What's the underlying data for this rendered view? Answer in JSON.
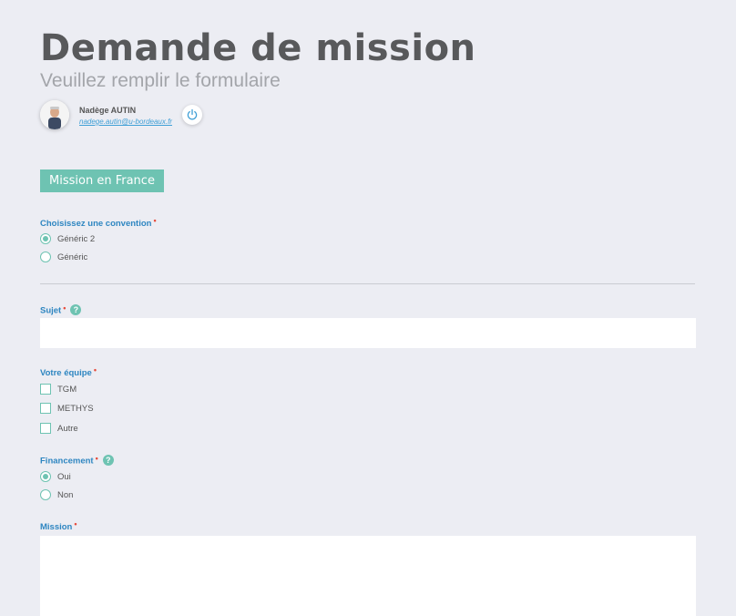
{
  "header": {
    "title": "Demande de mission",
    "subtitle": "Veuillez remplir le formulaire"
  },
  "user": {
    "name": "Nadège AUTIN",
    "email": "nadege.autin@u-bordeaux.fr",
    "avatar_icon": "user-avatar",
    "logout_icon": "power-icon"
  },
  "mission_badge": "Mission en France",
  "convention": {
    "label": "Choisissez une convention",
    "required_mark": "•",
    "options": [
      {
        "label": "Généric 2",
        "selected": true
      },
      {
        "label": "Généric",
        "selected": false
      }
    ]
  },
  "sujet": {
    "label": "Sujet",
    "required_mark": "•",
    "help": "?",
    "value": ""
  },
  "equipe": {
    "label": "Votre équipe",
    "required_mark": "•",
    "options": [
      {
        "label": "TGM",
        "checked": false
      },
      {
        "label": "METHYS",
        "checked": false
      },
      {
        "label": "Autre",
        "checked": false
      }
    ]
  },
  "financement": {
    "label": "Financement",
    "required_mark": "•",
    "help": "?",
    "options": [
      {
        "label": "Oui",
        "selected": true
      },
      {
        "label": "Non",
        "selected": false
      }
    ]
  },
  "mission": {
    "label": "Mission",
    "required_mark": "•",
    "value": ""
  },
  "colors": {
    "accent": "#6ec3b2",
    "label_blue": "#2e86c1",
    "required_red": "#e74c3c",
    "background": "#ecedf3"
  }
}
